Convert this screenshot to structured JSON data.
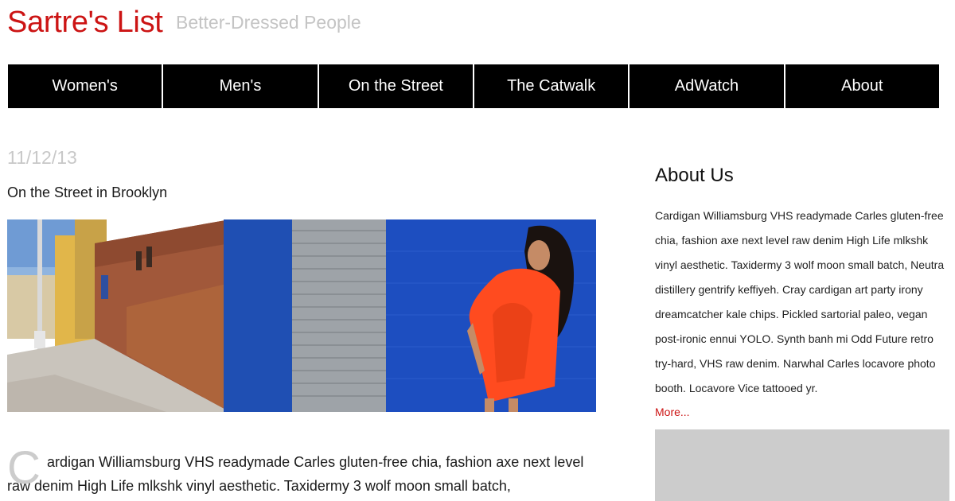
{
  "header": {
    "site_title": "Sartre's List",
    "tagline": "Better-Dressed People"
  },
  "nav": {
    "items": [
      {
        "label": "Women's"
      },
      {
        "label": "Men's"
      },
      {
        "label": "On the Street"
      },
      {
        "label": "The Catwalk"
      },
      {
        "label": "AdWatch"
      },
      {
        "label": "About"
      }
    ]
  },
  "post": {
    "date": "11/12/13",
    "title": "On the Street in Brooklyn",
    "drop_cap": "C",
    "body": "ardigan Williamsburg VHS readymade Carles gluten-free chia, fashion axe next level raw denim High Life mlkshk vinyl aesthetic. Taxidermy 3 wolf moon small batch,"
  },
  "sidebar": {
    "title": "About Us",
    "text": "Cardigan Williamsburg VHS readymade Carles gluten-free\nchia, fashion axe next level raw denim High Life mlkshk\nvinyl aesthetic. Taxidermy 3 wolf moon small batch, Neutra\ndistillery gentrify keffiyeh. Cray cardigan art party irony\ndreamcatcher kale chips. Pickled sartorial paleo, vegan\npost-ironic ennui YOLO. Synth banh mi Odd Future retro\ntry-hard, VHS raw denim. Narwhal Carles locavore photo\nbooth. Locavore Vice tattooed yr.",
    "more_label": "More..."
  },
  "colors": {
    "brand_red": "#cc1414",
    "nav_bg": "#000000",
    "muted_gray": "#c4c4c4"
  }
}
